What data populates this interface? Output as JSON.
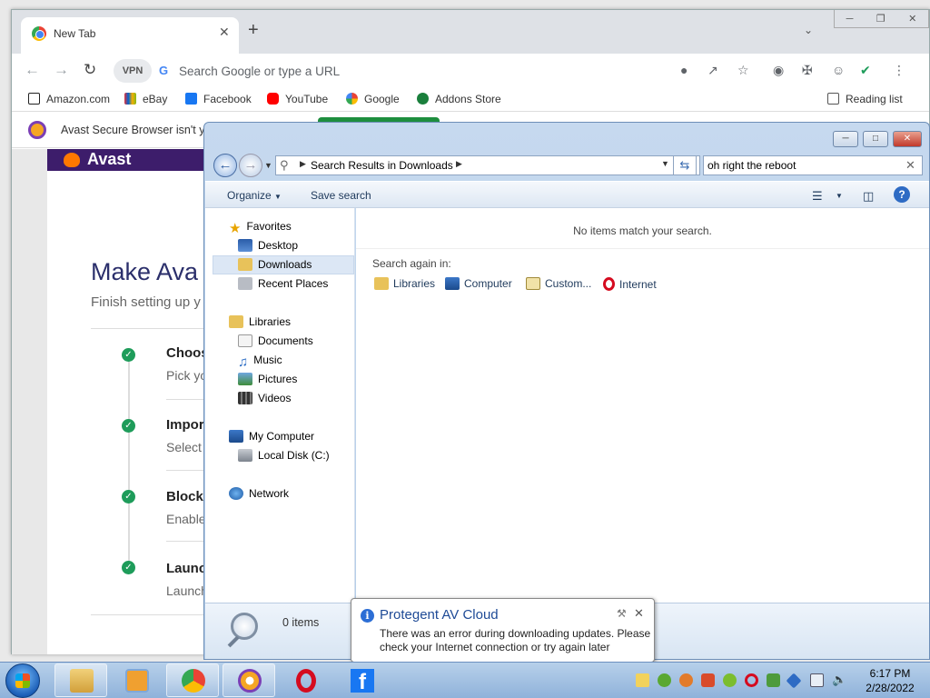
{
  "browser": {
    "tab_title": "New Tab",
    "tab_close": "✕",
    "new_tab": "+",
    "vpn_label": "VPN",
    "omnibox_placeholder": "Search Google or type a URL",
    "bookmarks": [
      "Amazon.com",
      "eBay",
      "Facebook",
      "YouTube",
      "Google",
      "Addons Store"
    ],
    "reading_list": "Reading list",
    "infobar_text": "Avast Secure Browser isn't y"
  },
  "avast_page": {
    "logo": "Avast",
    "heading": "Make Ava",
    "subheading": "Finish setting up y",
    "steps": [
      {
        "title": "Choos",
        "desc": "Pick yo"
      },
      {
        "title": "Impor",
        "desc": "Select"
      },
      {
        "title": "Block",
        "desc": "Enable"
      },
      {
        "title": "Launc",
        "desc": "Launch"
      }
    ]
  },
  "explorer": {
    "breadcrumb": "Search Results in Downloads",
    "search_value": "oh right the reboot",
    "commands": {
      "organize": "Organize",
      "save_search": "Save search"
    },
    "nav": {
      "favorites": "Favorites",
      "desktop": "Desktop",
      "downloads": "Downloads",
      "recent_places": "Recent Places",
      "libraries": "Libraries",
      "documents": "Documents",
      "music": "Music",
      "pictures": "Pictures",
      "videos": "Videos",
      "my_computer": "My Computer",
      "local_disk": "Local Disk (C:)",
      "network": "Network"
    },
    "no_items": "No items match your search.",
    "search_again_in": "Search again in:",
    "search_again_options": [
      "Libraries",
      "Computer",
      "Custom...",
      "Internet"
    ],
    "item_count": "0 items"
  },
  "notification": {
    "title": "Protegent AV Cloud",
    "message": "There was an error during downloading updates. Please check your Internet connection or try again later"
  },
  "taskbar": {
    "time": "6:17 PM",
    "date": "2/28/2022"
  },
  "colors": {
    "avast_purple": "#3d1d6b",
    "avast_orange": "#ff7800",
    "check_green": "#1e9c5a",
    "heading_navy": "#2b2f6b"
  }
}
